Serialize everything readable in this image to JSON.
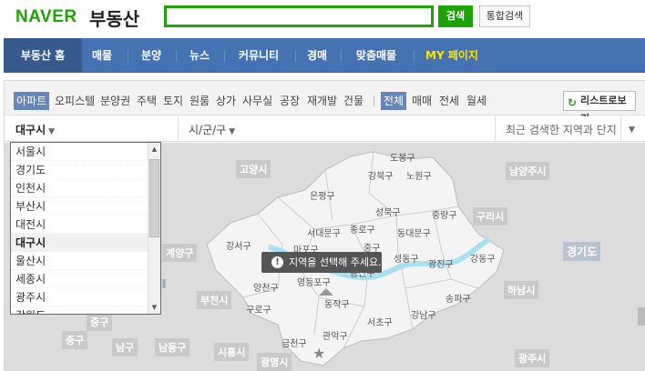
{
  "header": {
    "logo": "NAVER",
    "service": "부동산",
    "search_value": "",
    "search_button": "검색",
    "total_search_button": "통합검색"
  },
  "gnb": {
    "items": [
      {
        "label": "부동산 홈"
      },
      {
        "label": "매물"
      },
      {
        "label": "분양"
      },
      {
        "label": "뉴스"
      },
      {
        "label": "커뮤니티"
      },
      {
        "label": "경매"
      },
      {
        "label": "맞춤매물"
      },
      {
        "label": "MY 페이지"
      }
    ]
  },
  "filter": {
    "types": [
      "아파트",
      "오피스텔",
      "분양권",
      "주택",
      "토지",
      "원룸",
      "상가",
      "사무실",
      "공장",
      "재개발",
      "건물"
    ],
    "deals": [
      "전체",
      "매매",
      "전세",
      "월세"
    ],
    "list_button": "리스트로보기"
  },
  "region": {
    "city_selected": "대구시",
    "district_placeholder": "시/군/구",
    "recent_label": "최근 검색한 지역과 단지"
  },
  "dropdown": {
    "items": [
      "서울시",
      "경기도",
      "인천시",
      "부산시",
      "대전시",
      "대구시",
      "울산시",
      "세종시",
      "광주시",
      "강원도"
    ]
  },
  "map": {
    "tooltip": "지역을 선택해 주세요.",
    "region_labels": [
      "고양시",
      "남양주시",
      "구리시",
      "경기도",
      "하남시",
      "계양구",
      "부천시",
      "광명시",
      "시흥시",
      "남동구",
      "광주시",
      "중구",
      "남구",
      "중구"
    ],
    "gu_labels": [
      "도봉구",
      "강북구",
      "노원구",
      "은평구",
      "성북구",
      "중랑구",
      "서대문구",
      "종로구",
      "동대문구",
      "강서구",
      "마포구",
      "중구",
      "성동구",
      "광진구",
      "강동구",
      "영등포구",
      "용산구",
      "양천구",
      "구로구",
      "동작구",
      "서초구",
      "강남구",
      "송파구",
      "관악구",
      "금천구"
    ]
  },
  "colors": {
    "brand_green": "#1ea505",
    "gnb_blue": "#4472b2",
    "my_yellow": "#ffe400",
    "river": "#a9dff1"
  }
}
